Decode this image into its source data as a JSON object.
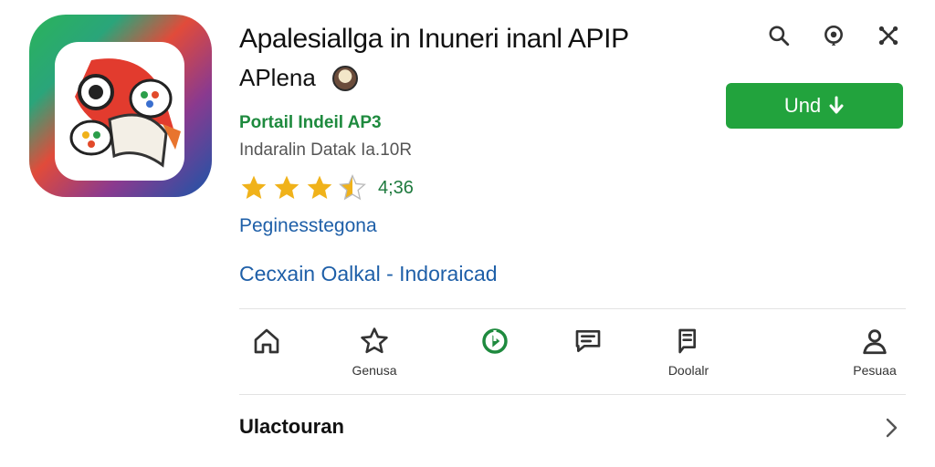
{
  "app": {
    "title": "Apalesiallga in Inuneri inanl APIP",
    "subtitle": "APlena",
    "developer": "Portail Indeil AP3",
    "meta": "Indaralin Datak Ia.10R",
    "rating": {
      "stars": 3.5,
      "max": 5,
      "value_text": "4;36"
    },
    "category": "Peginesstegona",
    "info_line": "Cecxain Oalkal - Indoraicad"
  },
  "actions": {
    "install_label": "Und",
    "install_icon": "arrow-down-icon",
    "install_color": "#22a33d"
  },
  "top_icons": [
    "search-icon",
    "location-pin-icon",
    "share-icon"
  ],
  "nav": {
    "items": [
      {
        "icon": "home-icon",
        "label": ""
      },
      {
        "icon": "star-icon",
        "label": "Genusa"
      },
      {
        "icon": "play-store-icon",
        "label": ""
      },
      {
        "icon": "chat-bubble-icon",
        "label": ""
      },
      {
        "icon": "document-icon",
        "label": "Doolalr"
      },
      {
        "icon": "person-icon",
        "label": "Pesuaa"
      }
    ]
  },
  "section": {
    "title": "Ulactouran",
    "chevron_icon": "chevron-right-icon"
  },
  "colors": {
    "accent_green": "#22a33d",
    "link_blue": "#1e5fa8",
    "star_gold": "#f0b21a"
  }
}
